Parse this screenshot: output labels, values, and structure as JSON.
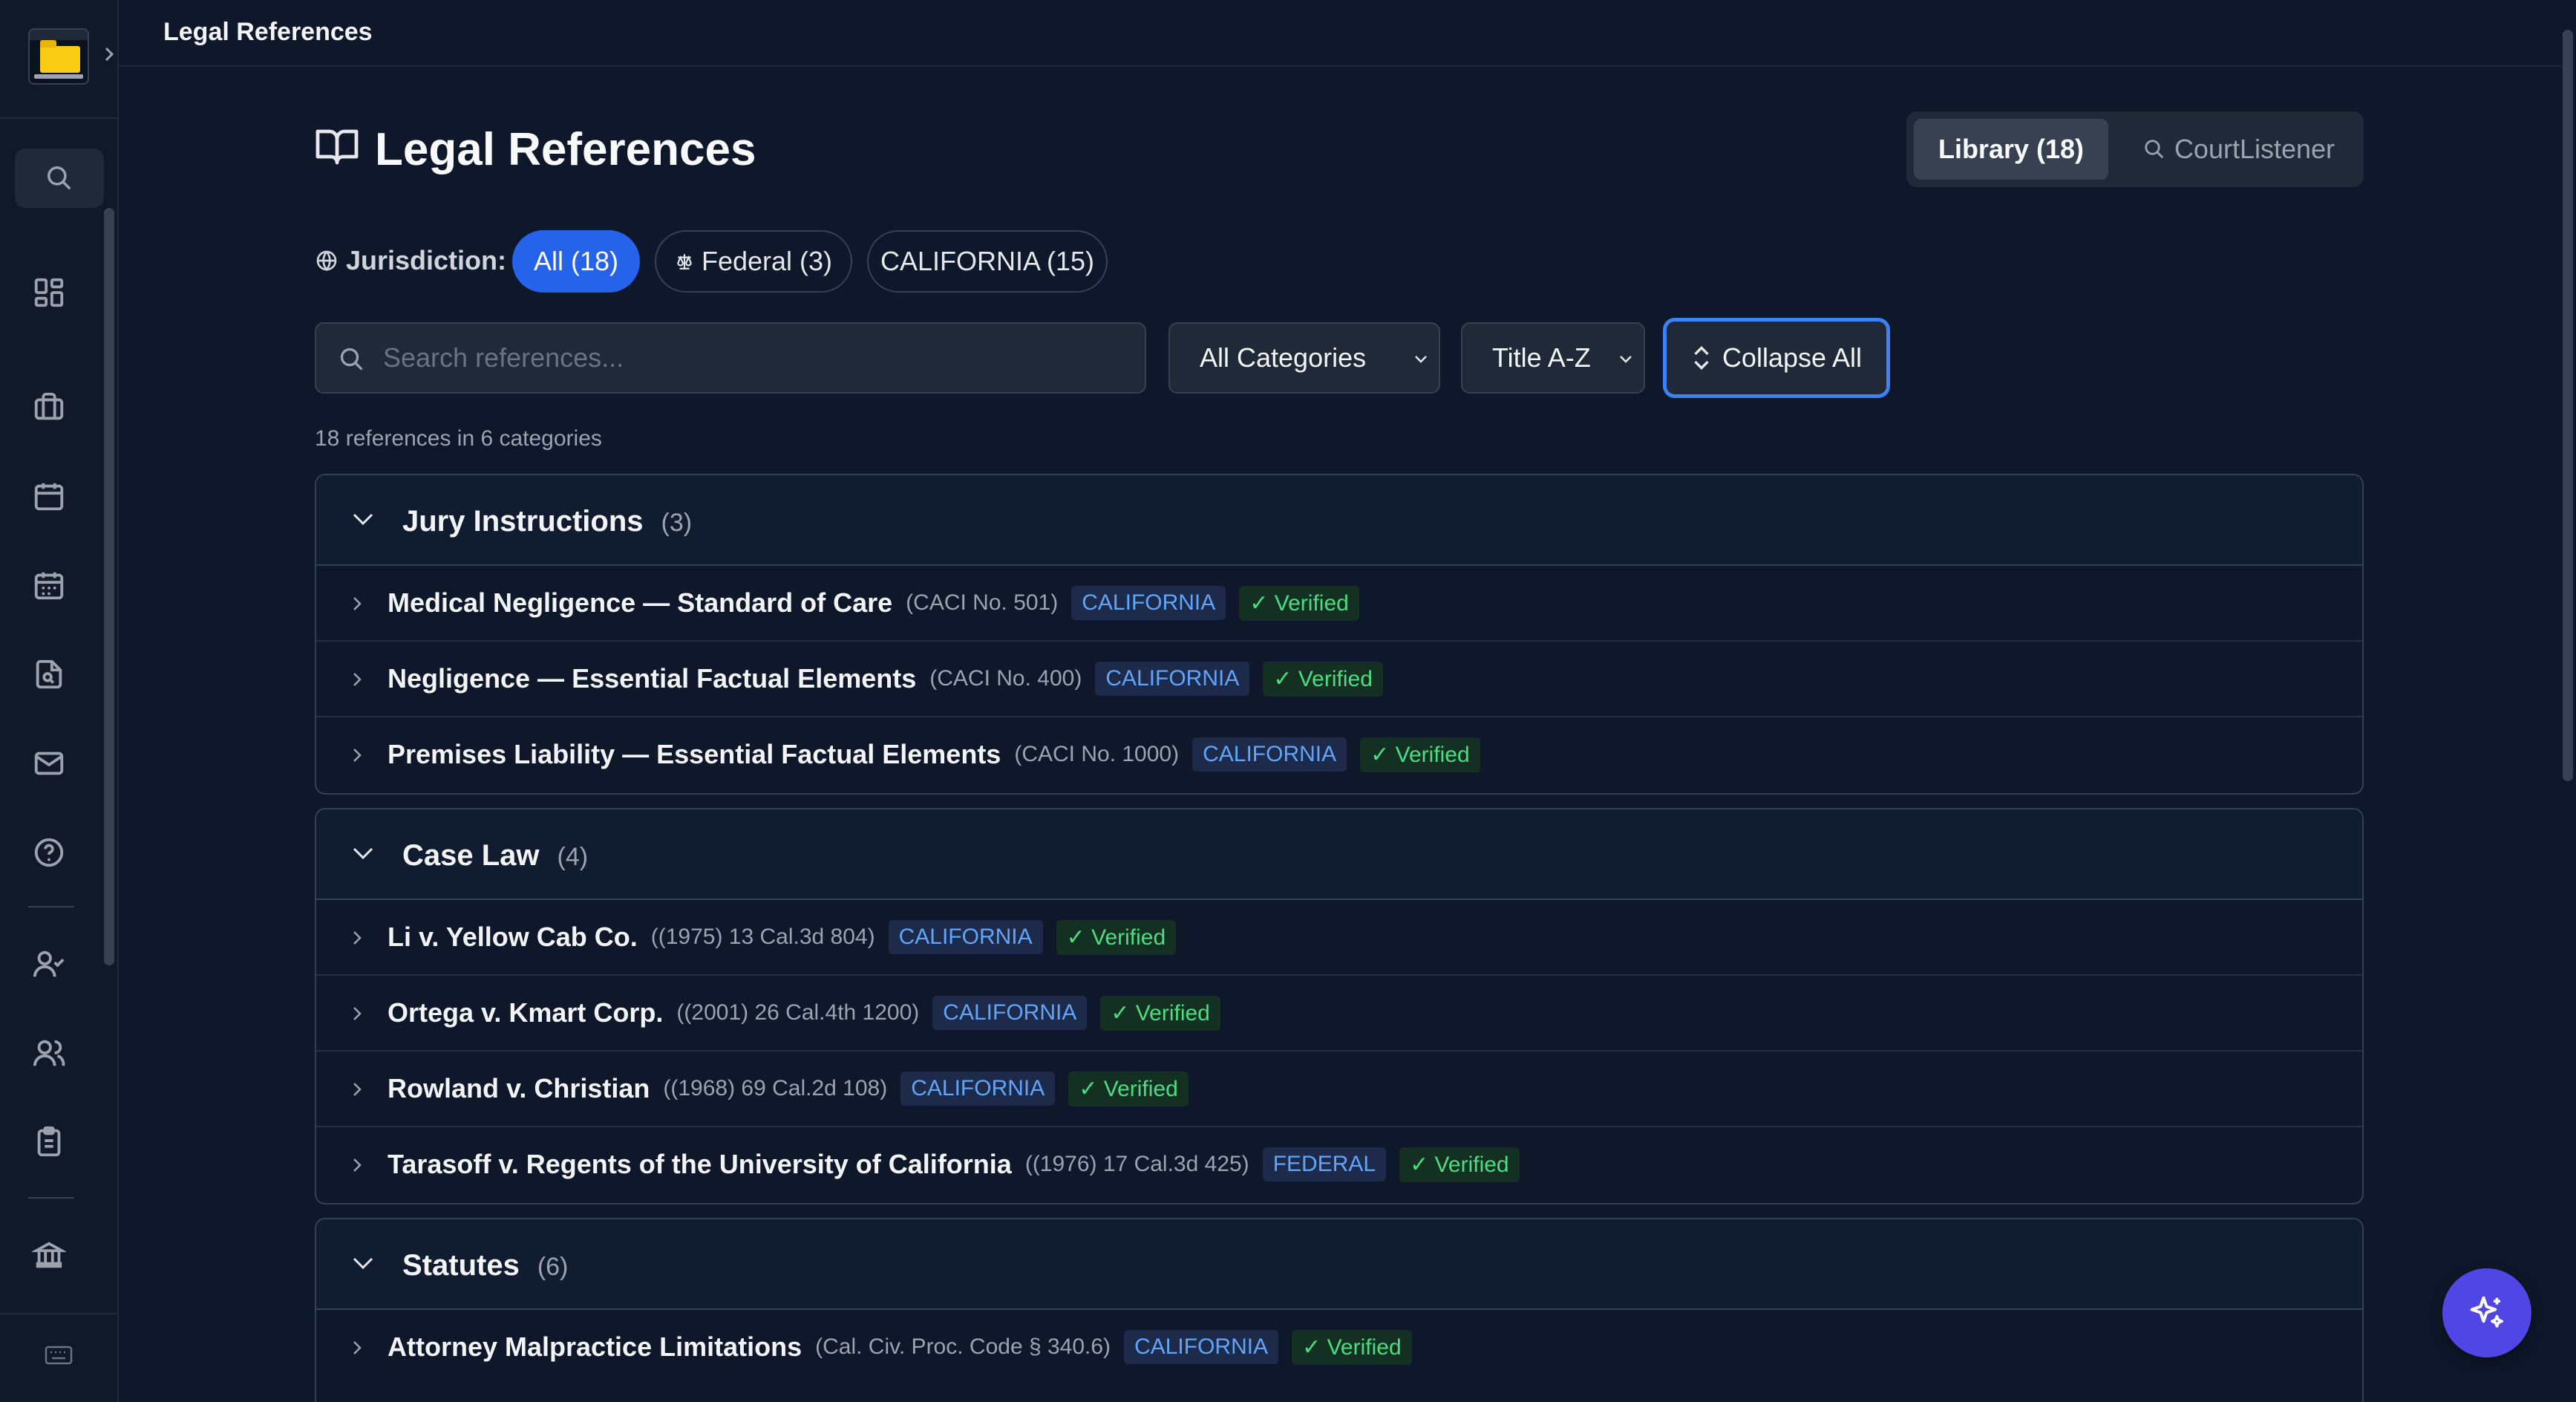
{
  "topbar": {
    "title": "Legal References"
  },
  "header": {
    "title": "Legal References"
  },
  "view_toggle": {
    "library": "Library (18)",
    "courtlistener": "CourtListener"
  },
  "jurisdiction": {
    "label": "Jurisdiction:",
    "pills": [
      {
        "label": "All (18)",
        "active": true
      },
      {
        "label": "Federal (3)",
        "active": false
      },
      {
        "label": "CALIFORNIA (15)",
        "active": false
      }
    ]
  },
  "filters": {
    "search_placeholder": "Search references...",
    "category_select": "All Categories",
    "sort_select": "Title A-Z",
    "collapse_all": "Collapse All"
  },
  "summary": "18 references in 6 categories",
  "sections": [
    {
      "name": "Jury Instructions",
      "count": "(3)",
      "rows": [
        {
          "title": "Medical Negligence — Standard of Care",
          "cite": "(CACI No. 501)",
          "jurisdiction": "CALIFORNIA",
          "status": "✓ Verified"
        },
        {
          "title": "Negligence — Essential Factual Elements",
          "cite": "(CACI No. 400)",
          "jurisdiction": "CALIFORNIA",
          "status": "✓ Verified"
        },
        {
          "title": "Premises Liability — Essential Factual Elements",
          "cite": "(CACI No. 1000)",
          "jurisdiction": "CALIFORNIA",
          "status": "✓ Verified"
        }
      ]
    },
    {
      "name": "Case Law",
      "count": "(4)",
      "rows": [
        {
          "title": "Li v. Yellow Cab Co.",
          "cite": "((1975) 13 Cal.3d 804)",
          "jurisdiction": "CALIFORNIA",
          "status": "✓ Verified"
        },
        {
          "title": "Ortega v. Kmart Corp.",
          "cite": "((2001) 26 Cal.4th 1200)",
          "jurisdiction": "CALIFORNIA",
          "status": "✓ Verified"
        },
        {
          "title": "Rowland v. Christian",
          "cite": "((1968) 69 Cal.2d 108)",
          "jurisdiction": "CALIFORNIA",
          "status": "✓ Verified"
        },
        {
          "title": "Tarasoff v. Regents of the University of California",
          "cite": "((1976) 17 Cal.3d 425)",
          "jurisdiction": "FEDERAL",
          "status": "✓ Verified"
        }
      ]
    },
    {
      "name": "Statutes",
      "count": "(6)",
      "rows": [
        {
          "title": "Attorney Malpractice Limitations",
          "cite": "(Cal. Civ. Proc. Code § 340.6)",
          "jurisdiction": "CALIFORNIA",
          "status": "✓ Verified"
        }
      ]
    }
  ],
  "icons": {
    "sidebar": [
      "search-icon",
      "dashboard-icon",
      "briefcase-icon",
      "calendar-icon",
      "calendar-grid-icon",
      "document-search-icon",
      "mail-icon",
      "help-icon",
      "user-check-icon",
      "users-icon",
      "clipboard-icon",
      "bank-icon",
      "keyboard-icon"
    ],
    "fab": "sparkles-icon"
  },
  "colors": {
    "accent": "#2563eb",
    "fab": "#4f46e5",
    "verified": "#4ade80",
    "jurisdiction": "#60a5fa"
  }
}
